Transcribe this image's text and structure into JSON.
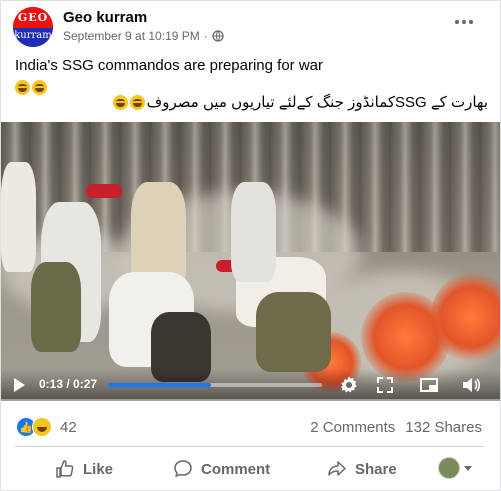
{
  "post": {
    "page_name": "Geo kurram",
    "avatar_text_top": "GEO",
    "avatar_text_bottom": "kurram",
    "timestamp": "September 9 at 10:19 PM",
    "audience_icon": "globe-icon",
    "text_line1": "India's SSG commandos are preparing for war",
    "emoji": "laughing-emoji",
    "text_urdu": "بھارت کے SSGکمانڈوز جنگ کےلئے تیاریوں میں مصروف"
  },
  "video": {
    "current_time": "0:13",
    "duration": "0:27",
    "progress": 0.48,
    "icons": [
      "play-icon",
      "settings-icon",
      "fullscreen-icon",
      "pip-icon",
      "volume-icon"
    ]
  },
  "reactions": {
    "count": "42",
    "types": [
      "like",
      "haha"
    ],
    "comments": "2 Comments",
    "shares": "132 Shares"
  },
  "actions": {
    "like": "Like",
    "comment": "Comment",
    "share": "Share"
  },
  "colors": {
    "accent": "#1877f2",
    "text_secondary": "#65676b"
  }
}
